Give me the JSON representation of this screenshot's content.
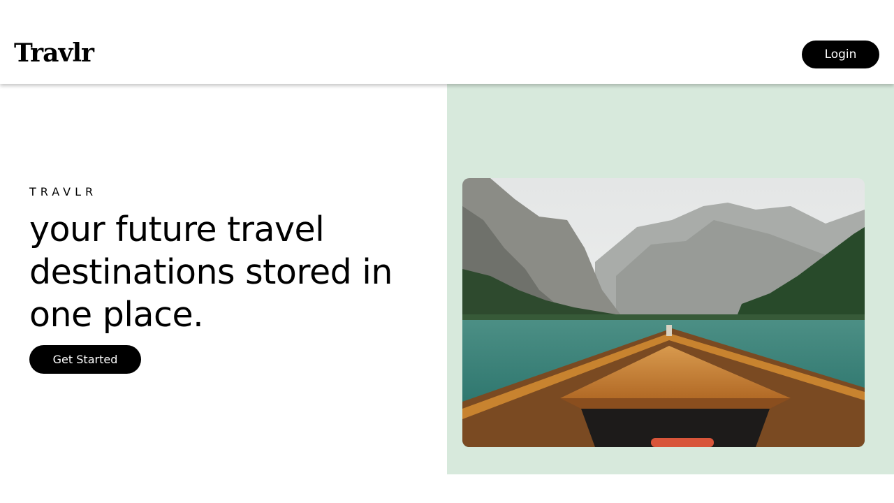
{
  "header": {
    "logo_text": "Travlr",
    "login_label": "Login"
  },
  "hero": {
    "eyebrow": "TRAVLR",
    "headline": "your future travel destinations stored in one place.",
    "cta_label": "Get Started"
  },
  "colors": {
    "accent_panel": "#d7e9dc",
    "button": "#000000",
    "button_text": "#ffffff"
  }
}
